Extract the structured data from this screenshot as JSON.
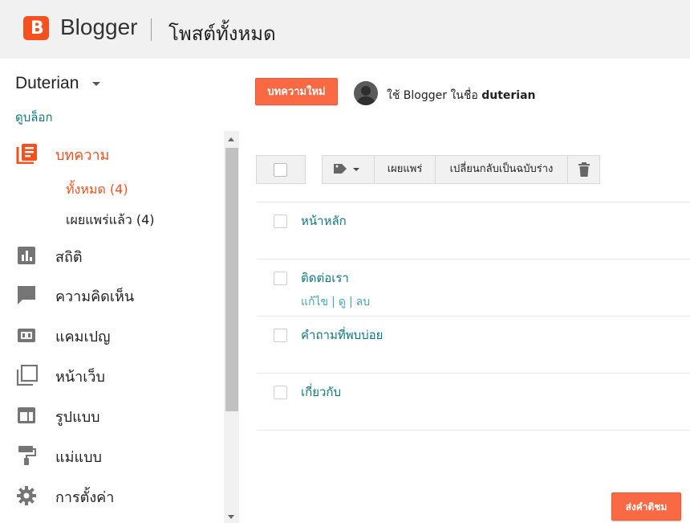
{
  "header": {
    "logo_letter": "B",
    "brand": "Blogger",
    "page_title": "โพสต์ทั้งหมด"
  },
  "sidebar": {
    "blog_name": "Duterian",
    "view_blog": "ดูบล็อก",
    "items": [
      {
        "label": "บทความ",
        "icon": "posts-icon",
        "active": true
      },
      {
        "label": "สถิติ",
        "icon": "stats-icon"
      },
      {
        "label": "ความคิดเห็น",
        "icon": "comments-icon"
      },
      {
        "label": "แคมเปญ",
        "icon": "campaigns-icon"
      },
      {
        "label": "หน้าเว็บ",
        "icon": "pages-icon"
      },
      {
        "label": "รูปแบบ",
        "icon": "layout-icon"
      },
      {
        "label": "แม่แบบ",
        "icon": "theme-icon"
      },
      {
        "label": "การตั้งค่า",
        "icon": "settings-icon"
      }
    ],
    "sub_items": [
      {
        "label": "ทั้งหมด (4)",
        "active": true
      },
      {
        "label": "เผยแพร่แล้ว (4)"
      }
    ]
  },
  "main": {
    "new_post": "บทความใหม่",
    "using_as_prefix": "ใช้ Blogger ในชื่อ",
    "username": "duterian",
    "toolbar": {
      "publish": "เผยแพร่",
      "revert": "เปลี่ยนกลับเป็นฉบับร่าง"
    },
    "posts": [
      {
        "title": "หน้าหลัก"
      },
      {
        "title": "ติดต่อเรา",
        "actions": [
          "แก้ไข",
          "ดู",
          "ลบ"
        ]
      },
      {
        "title": "คำถามที่พบบ่อย"
      },
      {
        "title": "เกี่ยวกับ"
      }
    ],
    "feedback": "ส่งคำติชม"
  },
  "colors": {
    "accent": "#f4511e",
    "link": "#0f7781",
    "button_orange": "#f96a44"
  }
}
